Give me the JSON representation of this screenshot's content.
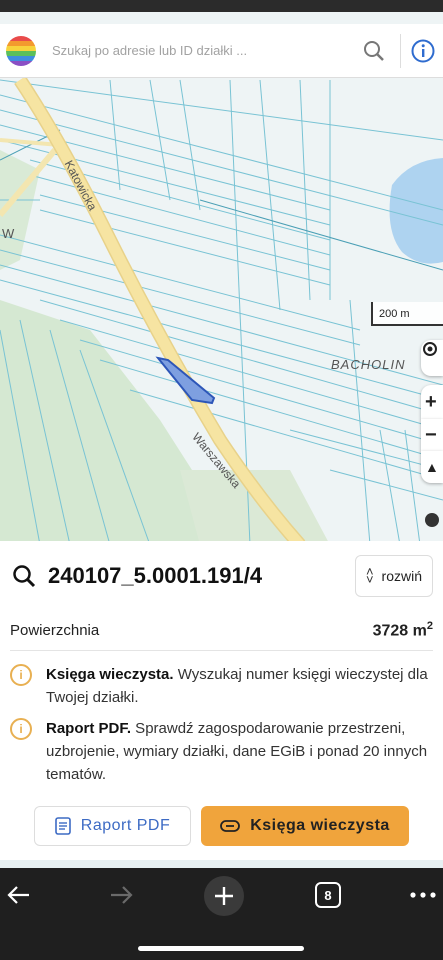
{
  "search": {
    "placeholder": "Szukaj po adresie lub ID działki ..."
  },
  "map": {
    "road_label_1": "Katowicka",
    "road_label_2": "Warszawska",
    "place_label": "BACHOLIN",
    "scale_label": "200 m",
    "edge_label": "W"
  },
  "panel": {
    "parcel_id": "240107_5.0001.191/4",
    "expand_label": "rozwiń",
    "area_label": "Powierzchnia",
    "area_value": "3728 m",
    "area_unit_sup": "2",
    "notice1_title": "Księga wieczysta.",
    "notice1_text": " Wyszukaj numer księgi wieczystej dla Twojej działki.",
    "notice2_title": "Raport PDF.",
    "notice2_text": " Sprawdź zagospodarowanie przestrzeni, uzbrojenie, wymiary działki, dane EGiB i ponad 20 innych tematów.",
    "btn_pdf": "Raport PDF",
    "btn_kw": "Księga wieczysta"
  },
  "browser": {
    "tab_count": "8"
  },
  "colors": {
    "accent_orange": "#f0a43c",
    "link_blue": "#3d6bc4",
    "road_yellow": "#f6e4a2",
    "water_blue": "#aed3f0",
    "parcel_fill": "#7e9fe0"
  }
}
